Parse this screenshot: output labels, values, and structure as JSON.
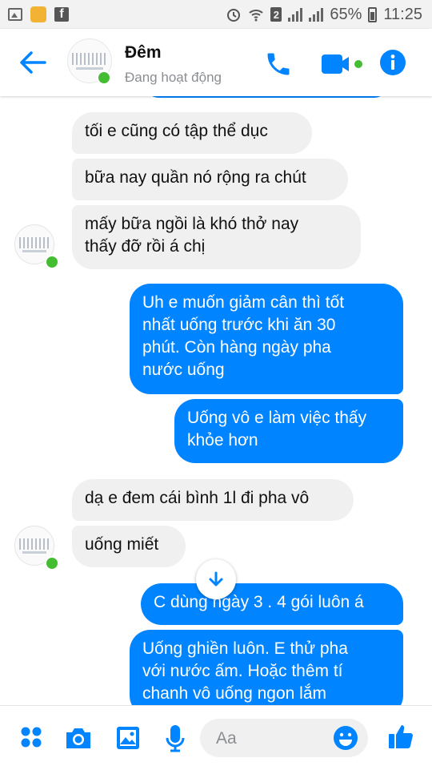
{
  "status_bar": {
    "battery": "65%",
    "time": "11:25",
    "sim": "2"
  },
  "header": {
    "name": "Đêm",
    "status": "Đang hoạt động"
  },
  "colors": {
    "accent": "#0084ff",
    "online": "#44bd32",
    "incoming_bubble": "#f1f0f0"
  },
  "messages": [
    {
      "side": "in",
      "text": "tối e cũng có tập thể dục"
    },
    {
      "side": "in",
      "text": "bữa nay quần nó rộng ra chút"
    },
    {
      "side": "in",
      "text": "mấy bữa ngồi là khó thở nay\nthấy đỡ rồi á chị"
    },
    {
      "side": "out",
      "text": "Uh e muốn giảm cân thì tốt\nnhất uống trước khi ăn 30\nphút. Còn hàng ngày pha\nnước uống"
    },
    {
      "side": "out",
      "text": "Uống vô e làm việc thấy\nkhỏe hơn"
    },
    {
      "side": "in",
      "text": "dạ e đem cái bình 1l đi pha vô"
    },
    {
      "side": "in",
      "text": "uống miết"
    },
    {
      "side": "out",
      "text": "C dùng ngày 3 . 4 gói luôn á"
    },
    {
      "side": "out",
      "text": "Uống ghiền luôn. E thử pha\nvới nước ấm. Hoặc thêm tí\nchanh vô uống ngon lắm"
    }
  ],
  "composer": {
    "placeholder": "Aa"
  },
  "icons": [
    "back-arrow-icon",
    "phone-icon",
    "video-call-icon",
    "info-icon",
    "menu-dots-icon",
    "camera-icon",
    "gallery-icon",
    "microphone-icon",
    "emoji-icon",
    "like-thumb-icon",
    "scroll-down-icon"
  ]
}
